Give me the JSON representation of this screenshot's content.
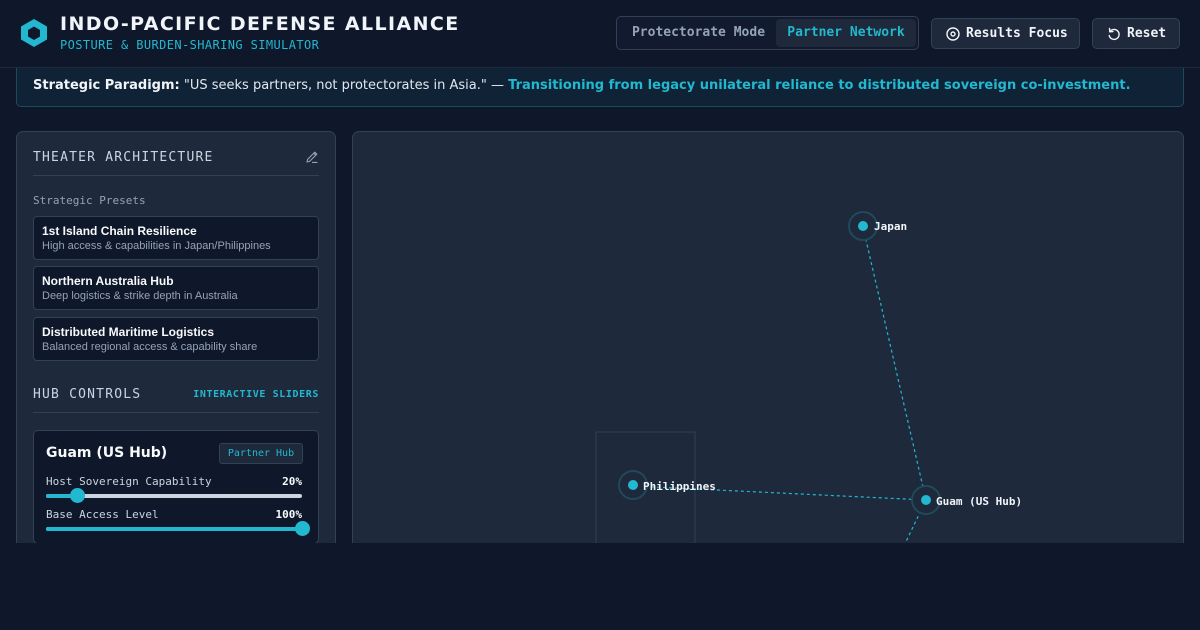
{
  "header": {
    "title": "INDO-PACIFIC DEFENSE ALLIANCE",
    "subtitle": "POSTURE & BURDEN-SHARING SIMULATOR",
    "modes": [
      "Protectorate Mode",
      "Partner Network"
    ],
    "active_mode": "Partner Network",
    "results_focus_label": "Results Focus",
    "reset_label": "Reset"
  },
  "banner": {
    "lead": "Strategic Paradigm:",
    "quote": "\"US seeks partners, not protectorates in Asia.\" —",
    "highlight": "Transitioning from legacy unilateral reliance to distributed sovereign co-investment."
  },
  "sidebar": {
    "title": "THEATER ARCHITECTURE",
    "presets_label": "Strategic Presets",
    "presets": [
      {
        "title": "1st Island Chain Resilience",
        "desc": "High access & capabilities in Japan/Philippines"
      },
      {
        "title": "Northern Australia Hub",
        "desc": "Deep logistics & strike depth in Australia"
      },
      {
        "title": "Distributed Maritime Logistics",
        "desc": "Balanced regional access & capability share"
      }
    ],
    "hub_controls_title": "HUB CONTROLS",
    "hub_controls_tag": "INTERACTIVE SLIDERS",
    "hub": {
      "name": "Guam (US Hub)",
      "badge": "Partner Hub",
      "sliders": [
        {
          "label": "Host Sovereign Capability",
          "value_text": "20%",
          "value": 0.12
        },
        {
          "label": "Base Access Level",
          "value_text": "100%",
          "value": 1.0
        }
      ]
    }
  },
  "map": {
    "nodes": [
      "Japan",
      "Philippines",
      "Guam (US Hub)"
    ],
    "accent_color": "#22b8cf"
  }
}
